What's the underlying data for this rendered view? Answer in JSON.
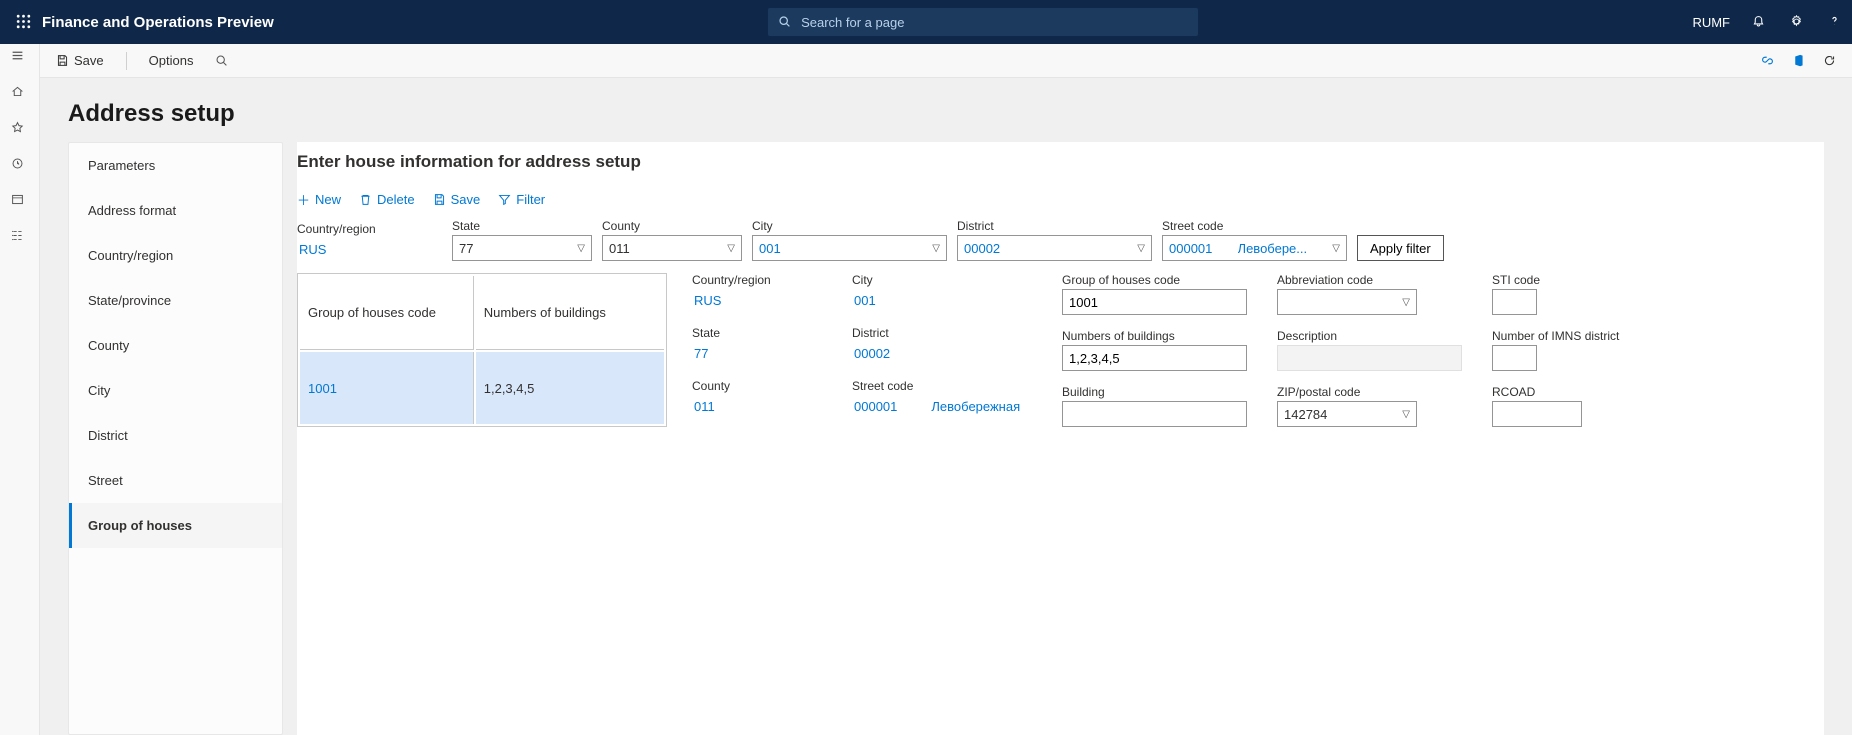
{
  "topnav": {
    "brand": "Finance and Operations Preview",
    "search_placeholder": "Search for a page",
    "user": "RUMF"
  },
  "actionbar": {
    "save": "Save",
    "options": "Options"
  },
  "page_title": "Address setup",
  "leftnav": [
    "Parameters",
    "Address format",
    "Country/region",
    "State/province",
    "County",
    "City",
    "District",
    "Street",
    "Group of houses"
  ],
  "leftnav_active": 8,
  "detail_heading": "Enter house information for address setup",
  "toolbar": {
    "new": "New",
    "delete": "Delete",
    "save": "Save",
    "filter": "Filter"
  },
  "filters": {
    "country_label": "Country/region",
    "country": "RUS",
    "state_label": "State",
    "state": "77",
    "county_label": "County",
    "county": "011",
    "city_label": "City",
    "city": "001",
    "district_label": "District",
    "district": "00002",
    "streetcode_label": "Street code",
    "streetcode": "000001",
    "street_name": "Левобере...",
    "apply": "Apply filter"
  },
  "grid": {
    "col1": "Group of houses code",
    "col2": "Numbers of buildings",
    "row": {
      "code": "1001",
      "nums": "1,2,3,4,5"
    }
  },
  "form": {
    "country_l": "Country/region",
    "country": "RUS",
    "state_l": "State",
    "state": "77",
    "county_l": "County",
    "county": "011",
    "city_l": "City",
    "city": "001",
    "district_l": "District",
    "district": "00002",
    "streetcode_l": "Street code",
    "streetcode": "000001",
    "streetname": "Левобережная",
    "group_l": "Group of houses code",
    "group": "1001",
    "nums_l": "Numbers of buildings",
    "nums": "1,2,3,4,5",
    "bld_l": "Building",
    "abbr_l": "Abbreviation code",
    "desc_l": "Description",
    "zip_l": "ZIP/postal code",
    "zip": "142784",
    "sti_l": "STI code",
    "imns_l": "Number of IMNS district",
    "rcoad_l": "RCOAD"
  }
}
